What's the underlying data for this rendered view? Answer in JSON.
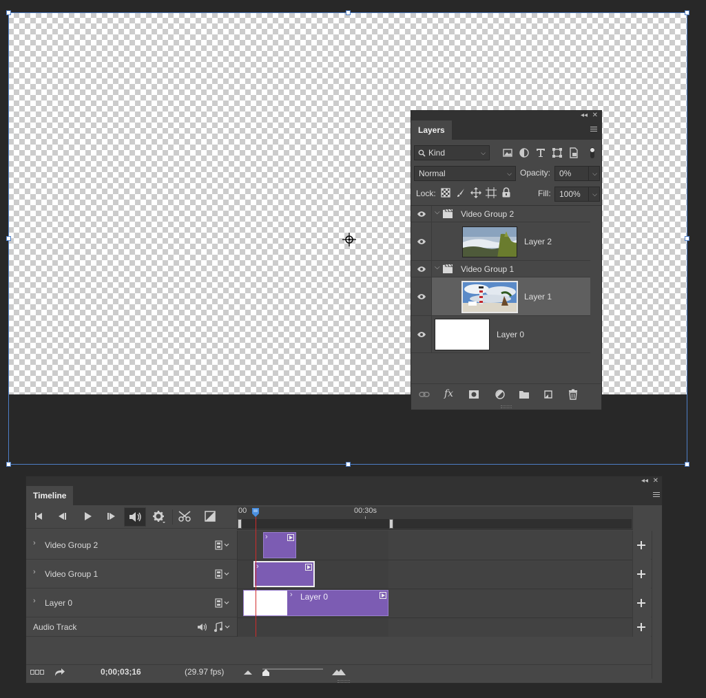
{
  "layers_panel": {
    "tab": "Layers",
    "filter_label": "Kind",
    "blend_mode": "Normal",
    "opacity_label": "Opacity:",
    "opacity_value": "0%",
    "lock_label": "Lock:",
    "fill_label": "Fill:",
    "fill_value": "100%",
    "layers": [
      {
        "name": "Video Group 2",
        "type": "group"
      },
      {
        "name": "Layer 2",
        "type": "layer"
      },
      {
        "name": "Video Group 1",
        "type": "group"
      },
      {
        "name": "Layer 1",
        "type": "layer",
        "selected": true
      },
      {
        "name": "Layer 0",
        "type": "layer"
      }
    ]
  },
  "timeline_panel": {
    "tab": "Timeline",
    "ruler_start": "00",
    "ruler_mark": "00:30s",
    "tracks": [
      {
        "name": "Video Group 2"
      },
      {
        "name": "Video Group 1"
      },
      {
        "name": "Layer 0",
        "clip_label": "Layer 0"
      },
      {
        "name": "Audio Track"
      }
    ],
    "timecode": "0;00;03;16",
    "fps": "(29.97 fps)"
  },
  "colors": {
    "background": "#282828",
    "panel": "#474747",
    "clip": "#7c5cb3",
    "playhead": "#d12b2b",
    "selection": "#4e7fc8"
  }
}
